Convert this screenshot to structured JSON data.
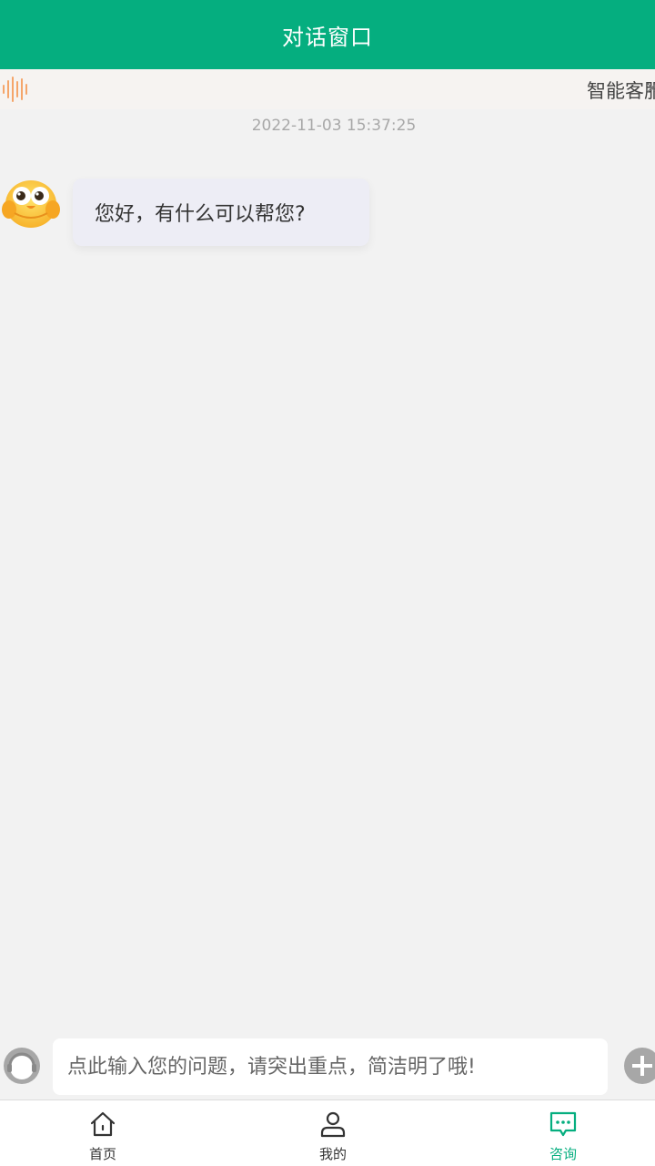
{
  "header": {
    "title": "对话窗口"
  },
  "notice": {
    "icon": "sound-wave-icon",
    "text": "智能客服",
    "close_icon": "close-icon",
    "close_text": "×"
  },
  "chat": {
    "timestamp": "2022-11-03 15:37:25",
    "messages": [
      {
        "sender": "bot",
        "avatar": "cartoon-chick-avatar",
        "text": "您好，有什么可以帮您?"
      }
    ]
  },
  "input_bar": {
    "left_icon": "customer-service-headset-icon",
    "placeholder": "点此输入您的问题，请突出重点，简洁明了哦!",
    "right_icon": "plus-icon"
  },
  "tabbar": {
    "items": [
      {
        "label": "首页",
        "icon": "home-icon",
        "active": false
      },
      {
        "label": "我的",
        "icon": "user-icon",
        "active": false
      },
      {
        "label": "咨询",
        "icon": "chat-bubble-icon",
        "active": true
      }
    ]
  },
  "colors": {
    "brand": "#05ae7f",
    "background": "#f2f2f2",
    "bubble": "#ededf5",
    "notice_icon": "#f5a56a"
  }
}
